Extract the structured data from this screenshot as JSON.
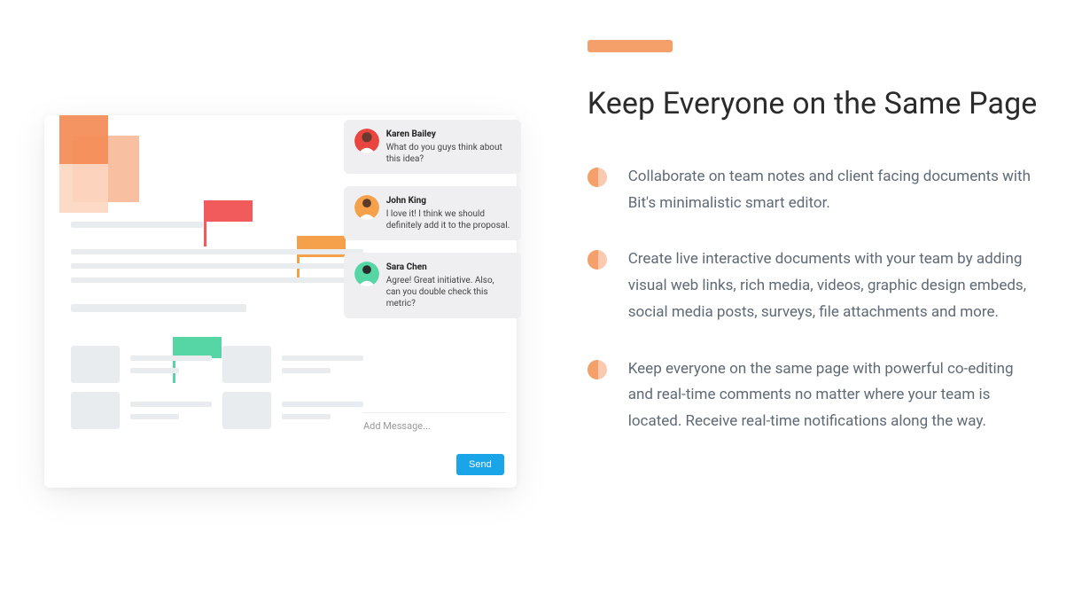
{
  "right": {
    "heading": "Keep Everyone on the Same Page",
    "bullets": [
      "Collaborate on team notes and client facing documents with Bit's minimalistic smart editor.",
      "Create live interactive documents with your team by adding visual web links, rich media, videos, graphic design embeds, social media posts, surveys, file attachments and more.",
      "Keep everyone on the same page with powerful co-editing and real-time comments no matter where your team is located. Receive real-time notifications along the way."
    ]
  },
  "comments": [
    {
      "name": "Karen Bailey",
      "text": "What do you guys think about this idea?"
    },
    {
      "name": "John King",
      "text": "I love it! I think we should definitely add it to the proposal."
    },
    {
      "name": "Sara Chen",
      "text": "Agree! Great initiative. Also, can you double check this metric?"
    }
  ],
  "compose": {
    "placeholder": "Add Message...",
    "send_label": "Send"
  }
}
